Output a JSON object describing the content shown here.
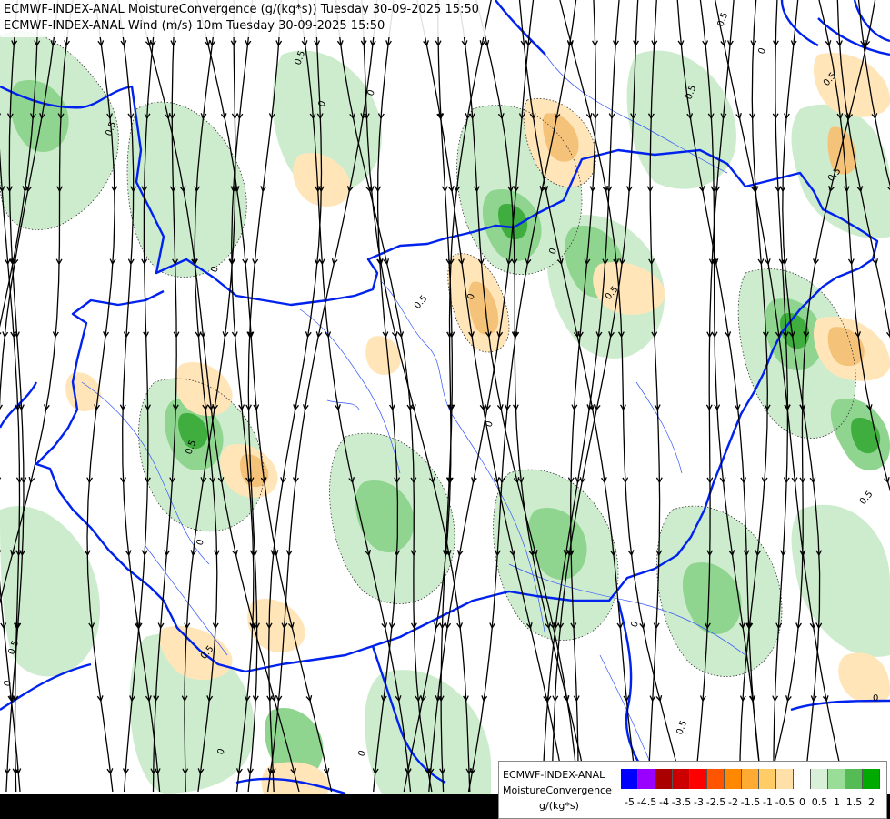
{
  "header": {
    "line1": "ECMWF-INDEX-ANAL MoistureConvergence (g/(kg*s)) Tuesday 30-09-2025 15:50",
    "line2": "ECMWF-INDEX-ANAL Wind (m/s) 10m Tuesday 30-09-2025 15:50"
  },
  "legend": {
    "model": "ECMWF-INDEX-ANAL",
    "parameter": "MoistureConvergence",
    "unit": "g/(kg*s)",
    "ticks": [
      "-5",
      "-4.5",
      "-4",
      "-3.5",
      "-3",
      "-2.5",
      "-2",
      "-1.5",
      "-1",
      "-0.5",
      "0",
      "0.5",
      "1",
      "1.5",
      "2"
    ],
    "colors": [
      "#0000ff",
      "#9900ff",
      "#aa0000",
      "#cc0000",
      "#ff0000",
      "#ff5500",
      "#ff8800",
      "#ffaa33",
      "#ffcc66",
      "#ffe0a8",
      "#ffffff",
      "#d8f0d8",
      "#99dd99",
      "#55bb55",
      "#00aa00"
    ]
  },
  "map": {
    "contour_labels": [
      "0",
      "0.5"
    ],
    "colors": {
      "border": "#0022ee",
      "river": "#3355ff",
      "streamline": "#000000",
      "convergence_light": "#cdeccd",
      "convergence_mid": "#8fd48f",
      "convergence_strong": "#3fae3f",
      "divergence_light": "#ffe5b8",
      "divergence_mid": "#f5c27a"
    }
  }
}
